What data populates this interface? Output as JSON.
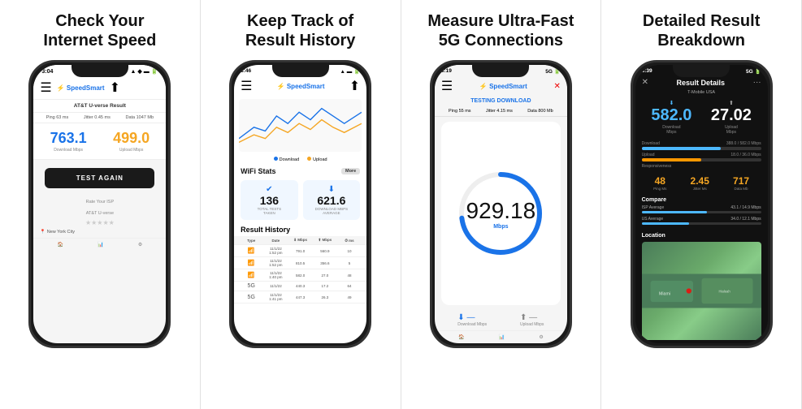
{
  "panels": [
    {
      "id": "panel1",
      "title": "Check Your\nInternet Speed",
      "phone": {
        "time": "3:04",
        "app_name": "SpeedSmart",
        "isp": "AT&T U-verse Result",
        "stats": "Ping 63 ms   Jitter 0.45 ms   Data 1047 Mb",
        "download_speed": "763.1",
        "upload_speed": "499.0",
        "download_label": "Download Mbps",
        "upload_label": "Upload Mbps",
        "test_btn": "TEST AGAIN",
        "isp_bottom": "AT&T U-verse",
        "location": "New York City"
      }
    },
    {
      "id": "panel2",
      "title": "Keep Track of\nResult History",
      "phone": {
        "time": "3:46",
        "app_name": "SpeedSmart",
        "wifi_stats_label": "WiFi Stats",
        "more_label": "More",
        "download_legend": "Download",
        "upload_legend": "Upload",
        "total_tests": "136",
        "total_tests_label": "TOTAL TESTS\nTAKEN",
        "avg_download": "621.6",
        "avg_download_label": "DOWNLOAD MBPS\nAVERAGE",
        "history_title": "Result History",
        "history_cols": [
          "Type",
          "Date",
          "⬇ Mbps",
          "⬆ Mbps",
          "⏱ ms"
        ],
        "history_rows": [
          [
            "📶",
            "11/1/22 1:52 pm",
            "791.0",
            "560.9",
            "10"
          ],
          [
            "📶",
            "11/1/22 1:52 pm",
            "810.5",
            "356.6",
            "5"
          ],
          [
            "📶",
            "11/1/22 1:40 pm",
            "582.0",
            "27.0",
            "48"
          ],
          [
            "5G",
            "11/1/22",
            "440.3",
            "17.2",
            "64"
          ],
          [
            "5G",
            "11/1/22 1:41 pm",
            "447.3",
            "26.3",
            "49"
          ]
        ]
      }
    },
    {
      "id": "panel3",
      "title": "Measure Ultra-Fast\n5G Connections",
      "phone": {
        "time": "3:19",
        "app_name": "SpeedSmart",
        "testing_label": "TESTING DOWNLOAD",
        "stats": "Ping 55 ms   Jitter 4.15 ms   Data 800 Mb",
        "big_number": "929.18",
        "unit": "Mbps",
        "download_icon": "⬇",
        "upload_icon": "⬆",
        "download_label": "Download Mbps",
        "upload_label": "Upload Mbps"
      }
    },
    {
      "id": "panel4",
      "title": "Detailed Result\nBreakdown",
      "phone": {
        "time": "3:39",
        "detail_title": "Result Details",
        "isp": "T-Mobile USA",
        "download_speed": "582.0",
        "upload_speed": "27.02",
        "download_label": "Download\nMbps",
        "upload_label": "Upload\nMbps",
        "dl_bar_label": "Download",
        "dl_bar_val": "388.0 / 582.0 Mbps",
        "ul_bar_label": "Upload",
        "ul_bar_val": "18.0 / 36.0 Mbps",
        "responsiveness_label": "Responsiveness",
        "ping": "48",
        "jitter": "2.45",
        "data": "717",
        "ping_label": "Ping Ms",
        "jitter_label": "Jitter Ms",
        "data_label": "Data Mb",
        "compare_title": "Compare",
        "isp_avg_label": "ISP Average",
        "isp_avg_val": "43.1 / 14.9 Mbps",
        "us_avg_label": "US Average",
        "us_avg_val": "34.0 / 12.1 Mbps",
        "location_title": "Location"
      }
    }
  ]
}
